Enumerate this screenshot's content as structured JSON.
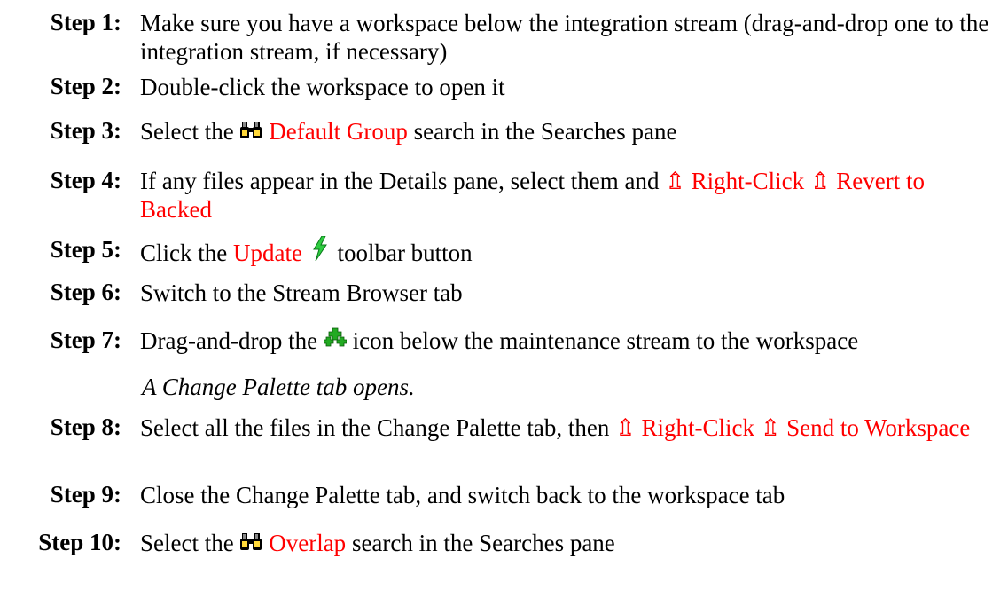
{
  "steps": [
    {
      "label": "Step 1:",
      "text": "Make sure you have a workspace below the integration stream (drag-and-drop one to the integration stream, if necessary)"
    },
    {
      "label": "Step 2:",
      "text": "Double-click the workspace to open it"
    },
    {
      "label": "Step 3:",
      "pre": "Select the",
      "link": "Default Group",
      "post": "search in the Searches pane",
      "icon": "binoculars-icon"
    },
    {
      "label": "Step 4:",
      "pre": "If any files appear in the Details pane, select them and",
      "arrow1": "⇬",
      "link1": "Right-Click",
      "arrow2": "⇬",
      "link2": "Revert to Backed"
    },
    {
      "label": "Step 5:",
      "pre": "Click the",
      "link": "Update",
      "post": "toolbar button",
      "icon": "lightning-icon"
    },
    {
      "label": "Step 6:",
      "text": "Switch to the Stream Browser tab"
    },
    {
      "label": "Step 7:",
      "pre": "Drag-and-drop the",
      "post": "icon below the maintenance stream to the workspace",
      "icon": "change-package-icon"
    },
    {
      "label": "Step 8:",
      "pre": "Select all the files in the Change Palette tab, then",
      "arrow1": "⇬",
      "link1": "Right-Click",
      "arrow2": "⇬",
      "link2": "Send to Workspace"
    },
    {
      "label": "Step 9:",
      "text": "Close the Change Palette tab, and switch back to the workspace tab"
    },
    {
      "label": "Step 10:",
      "pre": "Select the",
      "link": "Overlap",
      "post": "search in the Searches pane",
      "icon": "binoculars-icon"
    }
  ],
  "note": "A Change Palette tab opens.",
  "colors": {
    "link": "#ff0000",
    "text": "#000000",
    "lightning": "#2ecc40",
    "plus": "#22aa22"
  }
}
